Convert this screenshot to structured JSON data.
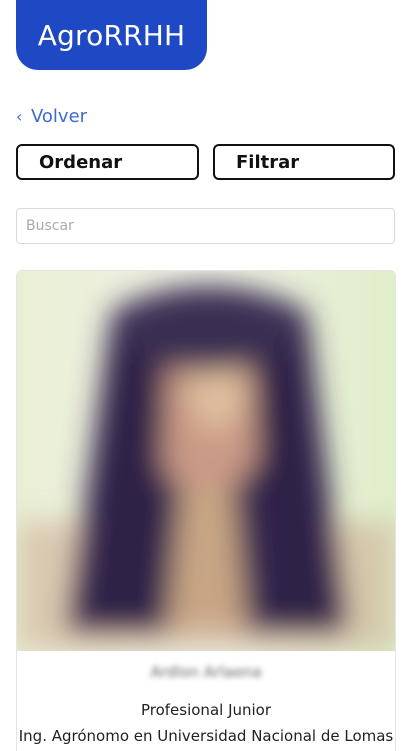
{
  "header": {
    "logo_text": "AgroRRHH",
    "brand_color": "#1f49c4"
  },
  "nav": {
    "back_label": "Volver",
    "back_icon": "chevron-left-icon"
  },
  "toolbar": {
    "sort_label": "Ordenar",
    "filter_label": "Filtrar"
  },
  "search": {
    "placeholder": "Buscar",
    "value": ""
  },
  "profile_card": {
    "name": "Ardlon Arlaena",
    "role": "Profesional Junior",
    "degree": "Ing. Agrónomo en Universidad Nacional de Lomas"
  }
}
